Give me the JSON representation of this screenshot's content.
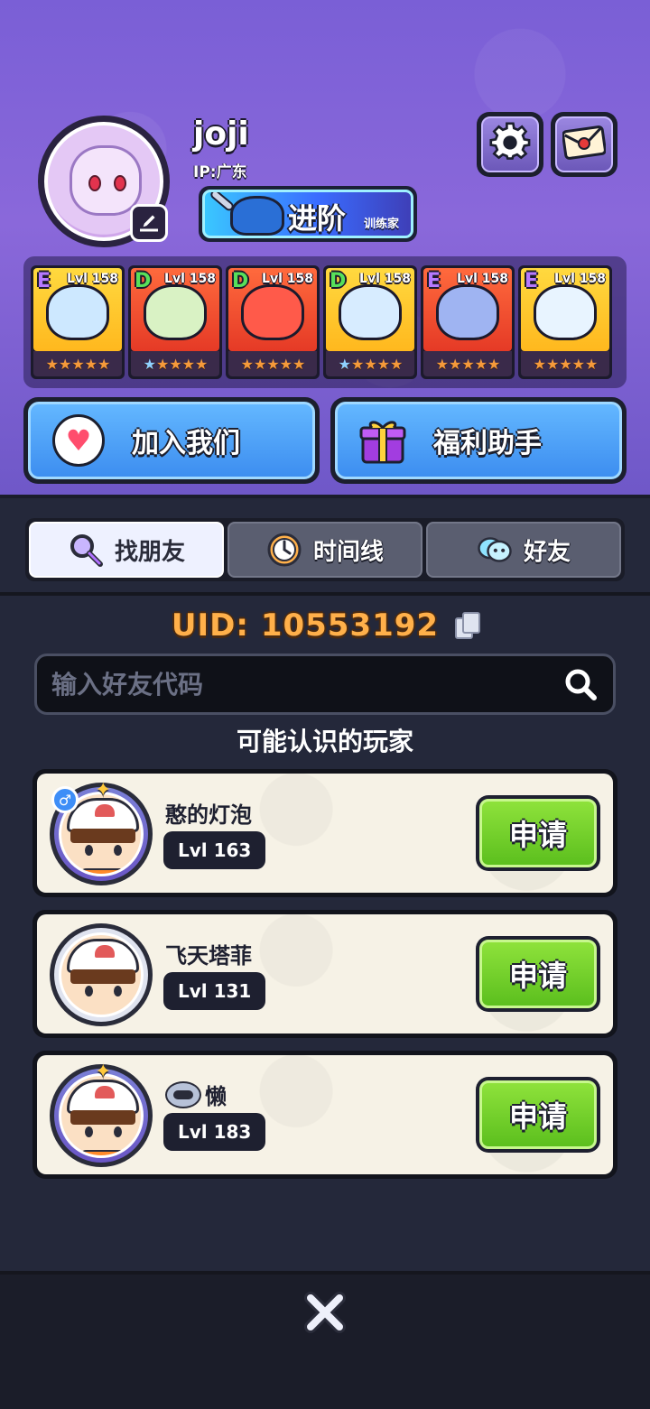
{
  "profile": {
    "name": "joji",
    "ip": "IP:广东",
    "rank": {
      "main": "进阶",
      "sub": "训练家"
    }
  },
  "team": [
    {
      "grade": "E",
      "level": "Lvl 158",
      "color": "#cde8ff",
      "bg": "yellow",
      "star_color": "orange"
    },
    {
      "grade": "D",
      "level": "Lvl 158",
      "color": "#d9f2c4",
      "bg": "red",
      "star_color": "blue"
    },
    {
      "grade": "D",
      "level": "Lvl 158",
      "color": "#ff5a4a",
      "bg": "red",
      "star_color": "orange"
    },
    {
      "grade": "D",
      "level": "Lvl 158",
      "color": "#d7ecff",
      "bg": "yellow",
      "star_color": "blue"
    },
    {
      "grade": "E",
      "level": "Lvl 158",
      "color": "#9fb4f2",
      "bg": "red",
      "star_color": "orange"
    },
    {
      "grade": "E",
      "level": "Lvl 158",
      "color": "#e8f4ff",
      "bg": "yellow",
      "star_color": "orange"
    }
  ],
  "actions": {
    "join_label": "加入我们",
    "welfare_label": "福利助手"
  },
  "tabs": [
    {
      "label": "找朋友",
      "icon": "magnifier-icon",
      "active": true
    },
    {
      "label": "时间线",
      "icon": "clock-icon",
      "active": false
    },
    {
      "label": "好友",
      "icon": "chat-bubbles-icon",
      "active": false
    }
  ],
  "uid": {
    "text": "UID:  10553192"
  },
  "search": {
    "placeholder": "输入好友代码",
    "value": ""
  },
  "suggest_title": "可能认识的玩家",
  "players": [
    {
      "name": "憨的灯泡",
      "level": "Lvl 163",
      "apply_label": "申请",
      "gender": "♂",
      "vip": false
    },
    {
      "name": "飞天塔菲",
      "level": "Lvl 131",
      "apply_label": "申请",
      "gender": "",
      "vip": false
    },
    {
      "name": "懒",
      "level": "Lvl 183",
      "apply_label": "申请",
      "gender": "",
      "vip": true
    }
  ],
  "colors": {
    "header_purple": "#7a5fd6",
    "accent_orange": "#ffb04a",
    "apply_green": "#6fcf2a",
    "button_blue": "#4a9ef5"
  }
}
